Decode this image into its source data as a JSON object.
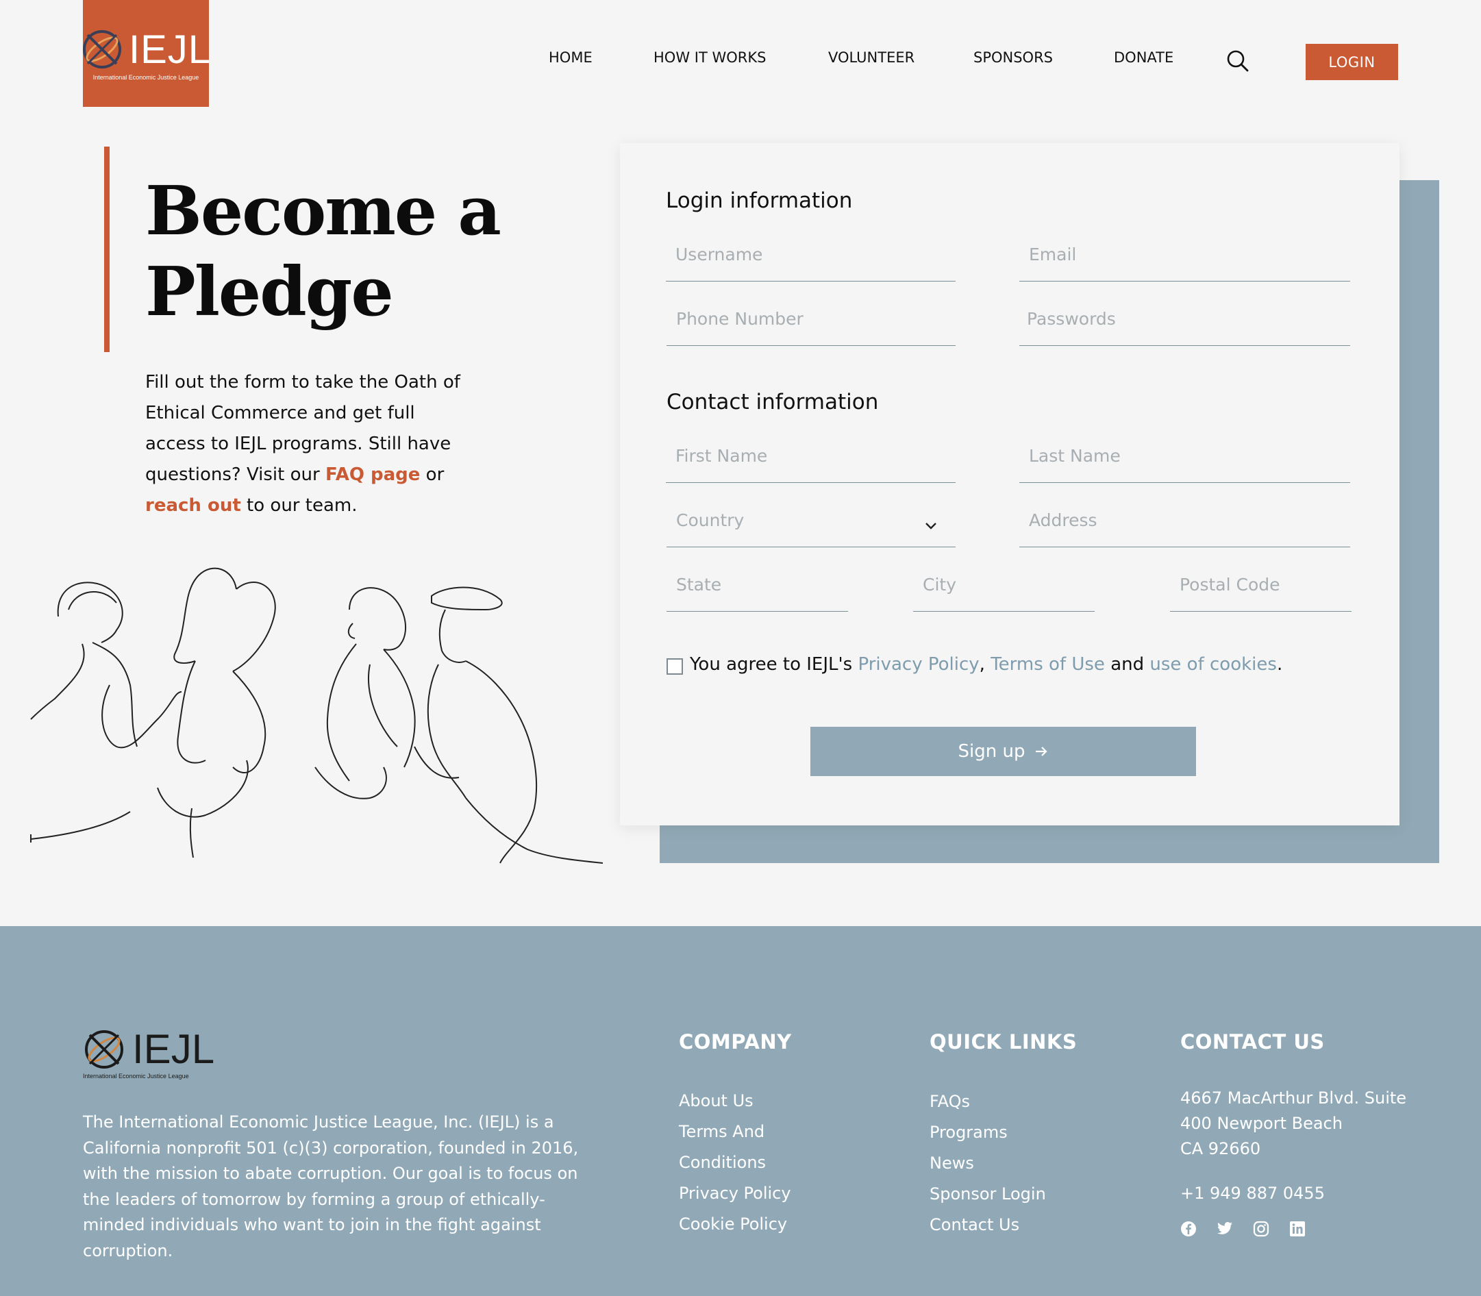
{
  "header": {
    "logo_text": "IEJL",
    "logo_subtitle": "International Economic Justice League",
    "nav": [
      "HOME",
      "HOW IT WORKS",
      "VOLUNTEER",
      "SPONSORS",
      "DONATE"
    ],
    "login_label": "LOGIN"
  },
  "hero": {
    "title_line1": "Become a",
    "title_line2": "Pledge",
    "text_1": "Fill out the form to take the Oath of Ethical Commerce and get full access to IEJL programs. Still have questions? Visit our ",
    "faq_link": "FAQ page",
    "text_2": " or ",
    "reach_link": "reach out",
    "text_3": " to our team."
  },
  "form": {
    "login_title": "Login information",
    "username_placeholder": "Username",
    "email_placeholder": "Email",
    "phone_placeholder": "Phone Number",
    "password_placeholder": "Passwords",
    "contact_title": "Contact information",
    "first_name_placeholder": "First Name",
    "last_name_placeholder": "Last Name",
    "country_placeholder": "Country",
    "address_placeholder": "Address",
    "state_placeholder": "State",
    "city_placeholder": "City",
    "postal_placeholder": "Postal Code",
    "agree_prefix": "You agree to IEJL's ",
    "privacy_link": "Privacy Policy",
    "comma": ",",
    "terms_link": "Terms of Use",
    "and": " and ",
    "cookies_link": "use of cookies",
    "period": ".",
    "signup_label": "Sign up"
  },
  "footer": {
    "logo_text": "IEJL",
    "logo_subtitle": "International Economic Justice League",
    "description": "The International Economic Justice League, Inc. (IEJL) is a California nonprofit 501 (c)(3) corporation, founded in 2016, with the mission to abate corruption. Our goal is to focus on the leaders of tomorrow by forming a group of ethically-minded individuals who want to join in the fight against corruption.",
    "company_title": "COMPANY",
    "company_links": [
      "About Us",
      "Terms And",
      "Conditions",
      "Privacy Policy",
      "Cookie Policy"
    ],
    "quick_title": "QUICK LINKS",
    "quick_links": [
      "FAQs",
      "Programs",
      "News",
      "Sponsor Login",
      "Contact Us"
    ],
    "contact_title": "CONTACT US",
    "address_lines": [
      "4667 MacArthur Blvd. Suite",
      "400 Newport Beach",
      "CA 92660"
    ],
    "phone": "+1 949 887 0455",
    "social_icons": [
      "facebook-icon",
      "twitter-icon",
      "instagram-icon",
      "linkedin-icon"
    ]
  },
  "colors": {
    "accent": "#c95a33",
    "slate": "#91a9b6",
    "link_muted": "#7e9cad",
    "background": "#f4f5f4"
  }
}
